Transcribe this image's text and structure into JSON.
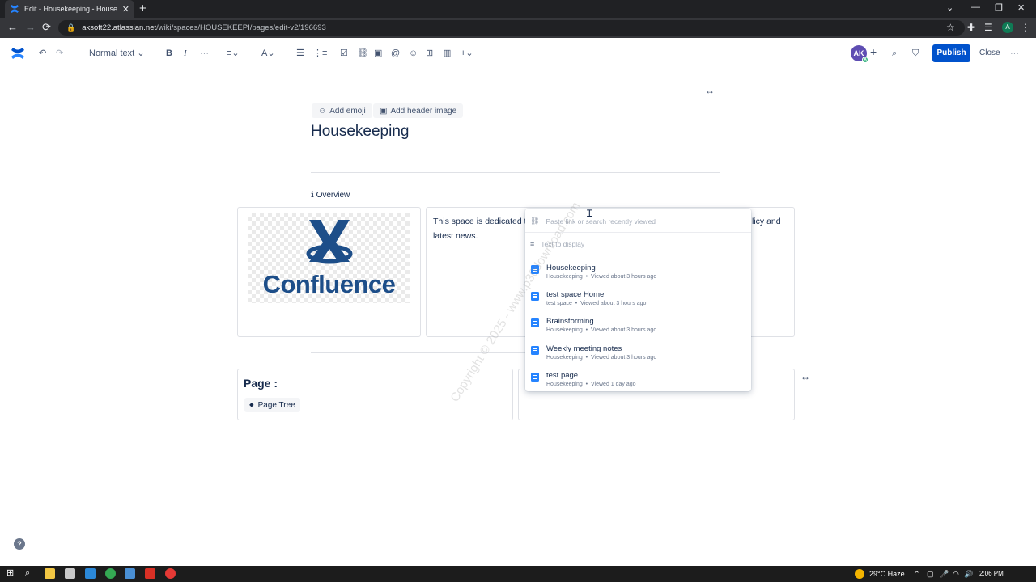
{
  "browser": {
    "tab_title": "Edit - Housekeeping - Housekeeping",
    "url_domain": "aksoft22.atlassian.net",
    "url_path": "/wiki/spaces/HOUSEKEEPI/pages/edit-v2/196693",
    "profile_initial": "A"
  },
  "toolbar": {
    "text_style": "Normal text",
    "avatar_initials": "AK",
    "avatar_badge": "A",
    "publish_label": "Publish",
    "close_label": "Close"
  },
  "page": {
    "add_emoji_label": "Add emoji",
    "add_header_label": "Add header image",
    "title": "Housekeeping",
    "overview_label": "Overview",
    "logo_text": "Confluence",
    "description_start": "This space is dedicated t",
    "description_tail": "licy and",
    "description_line2": "latest news.",
    "page_heading": "Page :",
    "page_tree_label": "Page Tree"
  },
  "link_popup": {
    "search_placeholder": "Paste link or search recently viewed",
    "text_placeholder": "Text to display",
    "results": [
      {
        "title": "Housekeeping",
        "space": "Housekeeping",
        "viewed": "Viewed about 3 hours ago"
      },
      {
        "title": "test space Home",
        "space": "test space",
        "viewed": "Viewed about 3 hours ago"
      },
      {
        "title": "Brainstorming",
        "space": "Housekeeping",
        "viewed": "Viewed about 3 hours ago"
      },
      {
        "title": "Weekly meeting notes",
        "space": "Housekeeping",
        "viewed": "Viewed about 3 hours ago"
      },
      {
        "title": "test page",
        "space": "Housekeeping",
        "viewed": "Viewed 1 day ago"
      }
    ]
  },
  "watermark": "Copyright © 2025 - www.p30download.com",
  "taskbar": {
    "weather": "29°C  Haze",
    "time": "2:06 PM"
  },
  "colors": {
    "primary": "#0052cc",
    "text": "#172b4d",
    "subtle": "#42526e",
    "avatar": "#5e4db2"
  }
}
